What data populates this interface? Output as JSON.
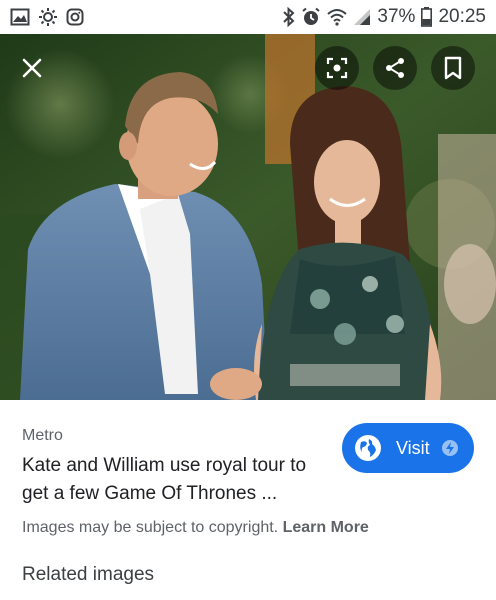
{
  "status_bar": {
    "battery": "37%",
    "time": "20:25",
    "icons": [
      "gallery-icon",
      "sun-icon",
      "instagram-icon",
      "bluetooth-icon",
      "alarm-icon",
      "wifi-icon",
      "signal-icon",
      "battery-icon"
    ]
  },
  "toolbar": {
    "icons": [
      "close-icon",
      "lens-icon",
      "share-icon",
      "bookmark-icon"
    ]
  },
  "result": {
    "source": "Metro",
    "title": "Kate and William use royal tour to get a few Game Of Thrones ...",
    "visit_label": "Visit",
    "visit_icon": "globe-icon",
    "copyright_text": "Images may be subject to copyright. ",
    "learn_more": "Learn More"
  },
  "related": {
    "heading": "Related images"
  },
  "colors": {
    "accent": "#1a73e8",
    "foliage": "#2e4a22"
  }
}
